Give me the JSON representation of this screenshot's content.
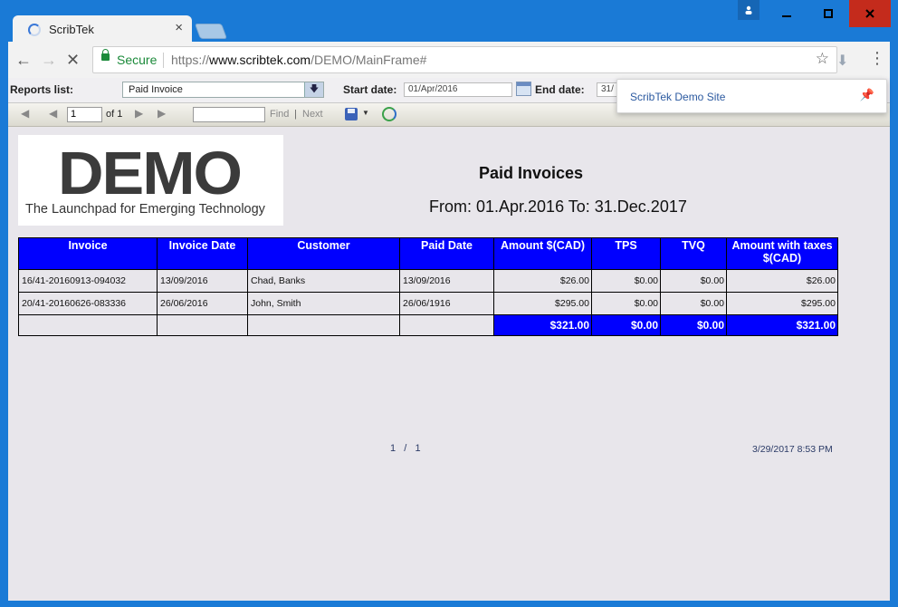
{
  "browser": {
    "tab_title": "ScribTek",
    "tab_close": "×",
    "secure_label": "Secure",
    "url_scheme": "https://",
    "url_host": "www.scribtek.com",
    "url_path": "/DEMO/MainFrame#",
    "window_min": "▁",
    "window_max": "☐",
    "window_close": "✕",
    "accent": "#1a7ad6"
  },
  "params": {
    "reports_label": "Reports list:",
    "report_selected": "Paid Invoice",
    "start_label": "Start date:",
    "start_value": "01/Apr/2016",
    "end_label": "End date:",
    "end_value": "31/"
  },
  "report_toolbar": {
    "page_value": "1",
    "of_label": "of 1",
    "find_label": "Find",
    "sep": "|",
    "next_label": "Next"
  },
  "popup": {
    "text": "ScribTek Demo Site"
  },
  "report": {
    "logo_text": "DEMO",
    "logo_tagline": "The Launchpad for Emerging Technology",
    "title": "Paid Invoices",
    "subtitle": "From: 01.Apr.2016 To: 31.Dec.2017",
    "columns": [
      "Invoice",
      "Invoice Date",
      "Customer",
      "Paid Date",
      "Amount $(CAD)",
      "TPS",
      "TVQ",
      "Amount with taxes $(CAD)"
    ],
    "rows": [
      [
        "16/41-20160913-094032",
        "13/09/2016",
        "Chad, Banks",
        "13/09/2016",
        "$26.00",
        "$0.00",
        "$0.00",
        "$26.00"
      ],
      [
        "20/41-20160626-083336",
        "26/06/2016",
        "John, Smith",
        "26/06/1916",
        "$295.00",
        "$0.00",
        "$0.00",
        "$295.00"
      ]
    ],
    "totals": [
      "$321.00",
      "$0.00",
      "$0.00",
      "$321.00"
    ],
    "page_indicator": "1   /   1",
    "timestamp": "3/29/2017 8:53 PM",
    "header_color": "#0000ff"
  }
}
